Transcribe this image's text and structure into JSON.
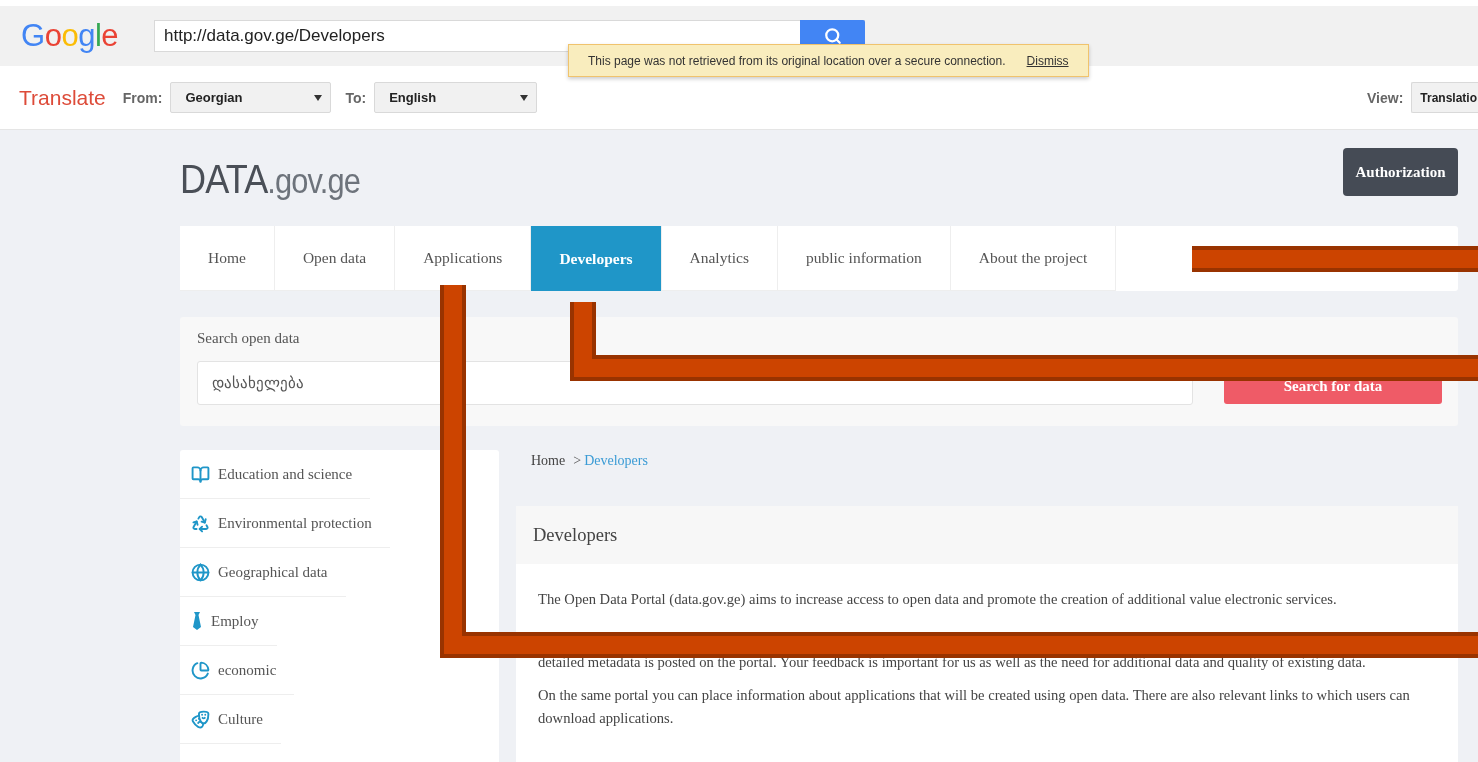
{
  "google_bar": {
    "logo": "Google",
    "url": "http://data.gov.ge/Developers"
  },
  "notice": {
    "message": "This page was not retrieved from its original location over a secure connection.",
    "action": "Dismiss"
  },
  "translate_bar": {
    "title": "Translate",
    "from_label": "From:",
    "from_value": "Georgian",
    "to_label": "To:",
    "to_value": "English",
    "view_label": "View:",
    "view_value": "Translatio"
  },
  "site": {
    "logo_main": "DATA",
    "logo_suffix": ".gov.ge",
    "auth_button": "Authorization"
  },
  "nav": [
    {
      "label": "Home",
      "selected": false
    },
    {
      "label": "Open data",
      "selected": false
    },
    {
      "label": "Applications",
      "selected": false
    },
    {
      "label": "Developers",
      "selected": true
    },
    {
      "label": "Analytics",
      "selected": false
    },
    {
      "label": "public information",
      "selected": false
    },
    {
      "label": "About the project",
      "selected": false
    }
  ],
  "search": {
    "label": "Search open data",
    "value": "დასახელება",
    "button": "Search for data"
  },
  "categories": [
    {
      "kind": "book",
      "label": "Education and science"
    },
    {
      "kind": "recycle",
      "label": "Environmental protection"
    },
    {
      "kind": "globe",
      "label": "Geographical data"
    },
    {
      "kind": "tie",
      "label": "Employ"
    },
    {
      "kind": "pie",
      "label": "economic"
    },
    {
      "kind": "masks",
      "label": "Culture"
    }
  ],
  "breadcrumb": {
    "home": "Home",
    "separator": ">",
    "current": "Developers"
  },
  "article": {
    "title": "Developers",
    "paragraphs": [
      "The Open Data Portal (data.gov.ge) aims to increase access to open data and promote the creation of additional value electronic services.",
      "detailed metadata is posted on the portal. Your feedback is important for us as well as the need for additional data and quality of existing data.",
      "On the same portal you can place information about applications that will be created using open data. There are also relevant links to which users can download applications."
    ]
  }
}
